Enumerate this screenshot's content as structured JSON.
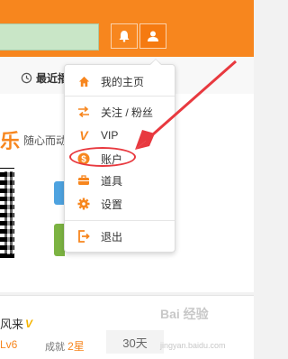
{
  "nav": {
    "recent_label": "最近播"
  },
  "banner": {
    "glyph": "乐",
    "text": "随心而动"
  },
  "menu": {
    "items": [
      {
        "label": "我的主页",
        "icon": "home-icon"
      },
      {
        "label": "关注 / 粉丝",
        "icon": "follow-icon"
      },
      {
        "label": "VIP",
        "icon": "vip-icon"
      },
      {
        "label": "账户",
        "icon": "account-coin-icon"
      },
      {
        "label": "道具",
        "icon": "props-icon"
      },
      {
        "label": "设置",
        "icon": "gear-icon"
      },
      {
        "label": "退出",
        "icon": "logout-icon"
      }
    ]
  },
  "card": {
    "username": "风来",
    "level": "Lv6",
    "achieve_label": "成就",
    "achieve_value": "2星",
    "days": "30天"
  },
  "watermark": {
    "main": "Bai 经验",
    "sub": "jingyan.baidu.com"
  },
  "colors": {
    "accent": "#f7861e",
    "annotation": "#e8393f"
  }
}
